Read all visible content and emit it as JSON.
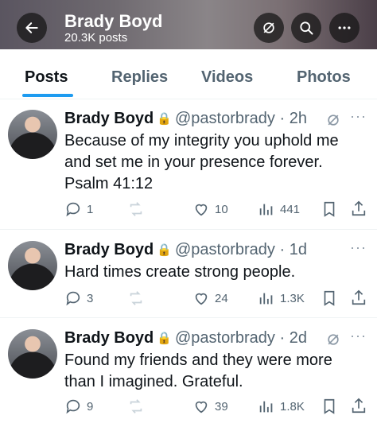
{
  "header": {
    "title": "Brady Boyd",
    "subtitle": "20.3K posts"
  },
  "tabs": [
    "Posts",
    "Replies",
    "Videos",
    "Photos"
  ],
  "posts": [
    {
      "name": "Brady Boyd",
      "handle": "@pastorbrady",
      "time": "2h",
      "text": "Because of my integrity you uphold me and set me in your presence forever. Psalm 41:12",
      "replies": "1",
      "likes": "10",
      "views": "441"
    },
    {
      "name": "Brady Boyd",
      "handle": "@pastorbrady",
      "time": "1d",
      "text": "Hard times create strong people.",
      "replies": "3",
      "likes": "24",
      "views": "1.3K"
    },
    {
      "name": "Brady Boyd",
      "handle": "@pastorbrady",
      "time": "2d",
      "text": "Found my friends and they were more than I imagined. Grateful.",
      "replies": "9",
      "likes": "39",
      "views": "1.8K"
    }
  ],
  "icons": {
    "back": "back-arrow-icon",
    "hide": "eye-slash-icon",
    "search": "search-icon",
    "more": "more-icon",
    "reply": "reply-icon",
    "repost": "repost-icon",
    "like": "heart-icon",
    "views": "views-icon",
    "bookmark": "bookmark-icon",
    "share": "share-icon"
  },
  "colors": {
    "accent": "#1d9bf0",
    "text": "#0f1419",
    "muted": "#536471"
  }
}
